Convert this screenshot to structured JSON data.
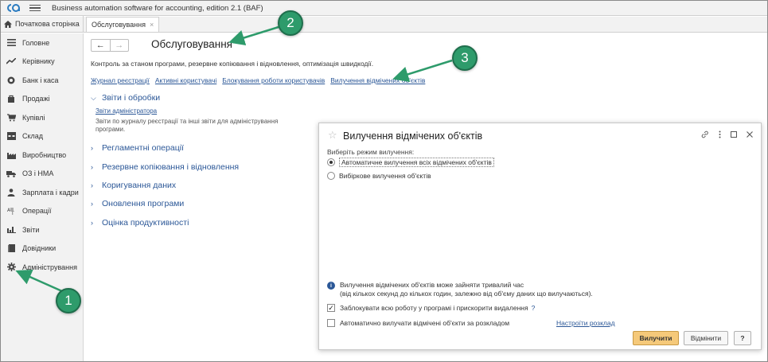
{
  "app": {
    "title": "Business automation software for accounting, edition 2.1  (BAF)"
  },
  "tabs": {
    "home_label": "Початкова сторінка",
    "open_tab_label": "Обслуговування",
    "close_glyph": "×"
  },
  "sidebar": {
    "items": [
      {
        "label": "Головне",
        "icon": "menu-lines-icon"
      },
      {
        "label": "Керівнику",
        "icon": "trend-icon"
      },
      {
        "label": "Банк і каса",
        "icon": "coin-icon"
      },
      {
        "label": "Продажі",
        "icon": "shopping-bag-icon"
      },
      {
        "label": "Купівлі",
        "icon": "cart-icon"
      },
      {
        "label": "Склад",
        "icon": "warehouse-icon"
      },
      {
        "label": "Виробництво",
        "icon": "factory-icon"
      },
      {
        "label": "ОЗ і НМА",
        "icon": "truck-icon"
      },
      {
        "label": "Зарплата і кадри",
        "icon": "person-icon"
      },
      {
        "label": "Операції",
        "icon": "operations-icon"
      },
      {
        "label": "Звіти",
        "icon": "bar-chart-icon"
      },
      {
        "label": "Довідники",
        "icon": "book-icon"
      },
      {
        "label": "Адміністрування",
        "icon": "gear-icon"
      }
    ]
  },
  "main": {
    "back_glyph": "←",
    "forward_glyph": "→",
    "title": "Обслуговування",
    "description": "Контроль за станом програми, резервне копіювання і відновлення, оптимізація швидкодії.",
    "links": [
      "Журнал реєстрації",
      "Активні користувачі",
      "Блокування роботи користувачів",
      "Вилучення відмічених об'єктів"
    ],
    "sections": [
      {
        "label": "Звіти і обробки",
        "expanded": true
      },
      {
        "label": "Регламентні операції",
        "expanded": false
      },
      {
        "label": "Резервне копіювання і відновлення",
        "expanded": false
      },
      {
        "label": "Коригування даних",
        "expanded": false
      },
      {
        "label": "Оновлення програми",
        "expanded": false
      },
      {
        "label": "Оцінка продуктивності",
        "expanded": false
      }
    ],
    "reports_link": "Звіти адміністратора",
    "reports_desc": "Звіти по журналу реєстрації та інші звіти для адміністрування програми."
  },
  "dialog": {
    "title": "Вилучення відмічених об'єктів",
    "mode_label": "Виберіть режим вилучення:",
    "radio_auto": "Автоматичне вилучення всіх відмічених об'єктів",
    "radio_selective": "Вибіркове вилучення об'єктів",
    "selected_mode": "auto",
    "info_line1": "Вилучення відмічених об'єктів може зайняти тривалий час",
    "info_line2": "(від кількох секунд до кількох годин, залежно від об'єму даних що вилучаються).",
    "lock_label": "Заблокувати всю роботу у програмі і прискорити видалення",
    "lock_checked": true,
    "help_glyph": "?",
    "schedule_label": "Автоматично вилучати відмічені об'єкти за розкладом",
    "schedule_checked": false,
    "schedule_link": "Настроїти розклад",
    "btn_delete": "Вилучити",
    "btn_cancel": "Відмінити",
    "btn_help": "?"
  },
  "callouts": [
    "1",
    "2",
    "3"
  ],
  "colors": {
    "link": "#2b5797",
    "callout": "#2e9b6b",
    "primary_button": "#f5c97a"
  }
}
